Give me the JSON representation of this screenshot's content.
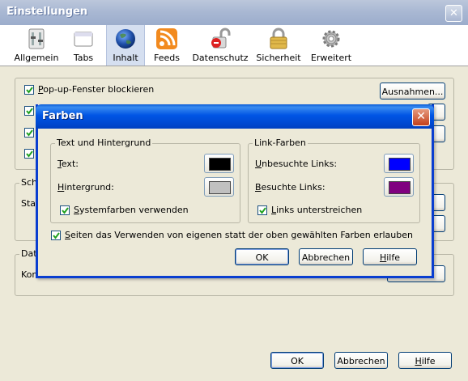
{
  "window": {
    "title": "Einstellungen"
  },
  "toolbar": {
    "items": [
      {
        "label": "Allgemein",
        "icon": "general-settings-icon"
      },
      {
        "label": "Tabs",
        "icon": "tabs-icon"
      },
      {
        "label": "Inhalt",
        "icon": "content-globe-icon"
      },
      {
        "label": "Feeds",
        "icon": "rss-feed-icon"
      },
      {
        "label": "Datenschutz",
        "icon": "privacy-lock-icon"
      },
      {
        "label": "Sicherheit",
        "icon": "security-padlock-icon"
      },
      {
        "label": "Erweitert",
        "icon": "advanced-gear-icon"
      }
    ],
    "active": "Inhalt"
  },
  "content": {
    "popup_block_label": "Pop-up-Fenster blockieren",
    "exceptions_button": "Ausnahmen...",
    "group2_label_partial": "Sch",
    "group2_row_partial": "Star",
    "group3_label_partial": "Date",
    "group3_row_partial": "Kon"
  },
  "footer": {
    "ok": "OK",
    "cancel": "Abbrechen",
    "help": "Hilfe"
  },
  "dialog": {
    "title": "Farben",
    "text_group": {
      "label": "Text und Hintergrund",
      "text_label": "Text:",
      "background_label": "Hintergrund:",
      "system_colors_label": "Systemfarben verwenden",
      "text_color": "#000000",
      "background_color": "#c0c0c0"
    },
    "link_group": {
      "label": "Link-Farben",
      "unvisited_label": "Unbesuchte Links:",
      "visited_label": "Besuchte Links:",
      "underline_label": "Links unterstreichen",
      "unvisited_color": "#0000ff",
      "visited_color": "#800080"
    },
    "allow_pages_label": "Seiten das Verwenden von eigenen statt der oben gewählten Farben erlauben",
    "ok": "OK",
    "cancel": "Abbrechen",
    "help": "Hilfe"
  },
  "colors": {
    "window_bg": "#ece9d8",
    "dialog_title_blue": "#0055e5",
    "button_border": "#003c74",
    "checkbox_mark": "#21a121"
  }
}
